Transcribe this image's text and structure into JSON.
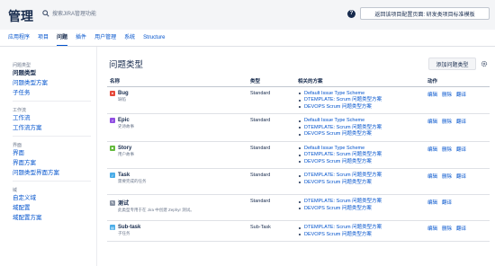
{
  "header": {
    "title": "管理",
    "search_placeholder": "搜索JIRA管理功能",
    "help_icon_label": "?",
    "return_button": "返回该项目配置页面: 研发类项目标准模板"
  },
  "topnav": {
    "tabs": [
      {
        "label": "应用程序",
        "active": false
      },
      {
        "label": "项目",
        "active": false
      },
      {
        "label": "问题",
        "active": true
      },
      {
        "label": "插件",
        "active": false
      },
      {
        "label": "用户管理",
        "active": false
      },
      {
        "label": "系统",
        "active": false
      },
      {
        "label": "Structure",
        "active": false
      }
    ]
  },
  "sidebar": {
    "section1": "问题类型",
    "items1": [
      "问题类型",
      "问题类型方案",
      "子任务"
    ],
    "section2": "工作流",
    "items2": [
      "工作流",
      "工作流方案"
    ],
    "section3": "界面",
    "items3": [
      "界面",
      "界面方案",
      "问题类型界面方案"
    ],
    "section4": "域",
    "items4": [
      "自定义域",
      "域配置",
      "域配置方案"
    ]
  },
  "main": {
    "page_title": "问题类型",
    "add_button": "添加问题类型",
    "columns": {
      "name": "名称",
      "type": "类型",
      "scheme": "相关的方案",
      "actions": "动作"
    },
    "actions": {
      "edit": "编辑",
      "delete": "删除",
      "translate": "翻译"
    },
    "rows": [
      {
        "name": "Bug",
        "desc": "缺陷",
        "type": "Standard",
        "icon_color": "#e5493a",
        "icon_glyph": "●",
        "schemes": [
          "Default Issue Type Scheme",
          "DTEMPLATE: Scrum 问题类型方案",
          "DEVOPS Scrum 问题类型方案"
        ],
        "has_delete": true
      },
      {
        "name": "Epic",
        "desc": "史诗故事",
        "type": "Standard",
        "icon_color": "#904ee2",
        "icon_glyph": "⚡",
        "schemes": [
          "Default Issue Type Scheme",
          "DTEMPLATE: Scrum 问题类型方案",
          "DEVOPS Scrum 问题类型方案"
        ],
        "has_delete": true
      },
      {
        "name": "Story",
        "desc": "用户故事",
        "type": "Standard",
        "icon_color": "#63ba3c",
        "icon_glyph": "■",
        "schemes": [
          "Default Issue Type Scheme",
          "DTEMPLATE: Scrum 问题类型方案",
          "DEVOPS Scrum 问题类型方案"
        ],
        "has_delete": true
      },
      {
        "name": "Task",
        "desc": "需要完成的任务",
        "type": "Standard",
        "icon_color": "#4bade8",
        "icon_glyph": "✓",
        "schemes": [
          "DTEMPLATE: Scrum 问题类型方案",
          "DEVOPS Scrum 问题类型方案"
        ],
        "has_delete": true
      },
      {
        "name": "测试",
        "desc": "此类型专用于在 Jira 中创建 Zephyr 测试。",
        "type": "Standard",
        "icon_color": "#8993a4",
        "icon_glyph": "✎",
        "schemes": [
          "DTEMPLATE: Scrum 问题类型方案",
          "DEVOPS Scrum 问题类型方案"
        ],
        "has_delete": false
      },
      {
        "name": "Sub-task",
        "desc": "子任务",
        "type": "Sub-Task",
        "icon_color": "#4bade8",
        "icon_glyph": "▤",
        "schemes": [
          "DTEMPLATE: Scrum 问题类型方案",
          "DEVOPS Scrum 问题类型方案"
        ],
        "has_delete": true
      }
    ]
  },
  "icons": {
    "search": "search-icon",
    "help": "help-icon",
    "settings": "cog-icon"
  }
}
